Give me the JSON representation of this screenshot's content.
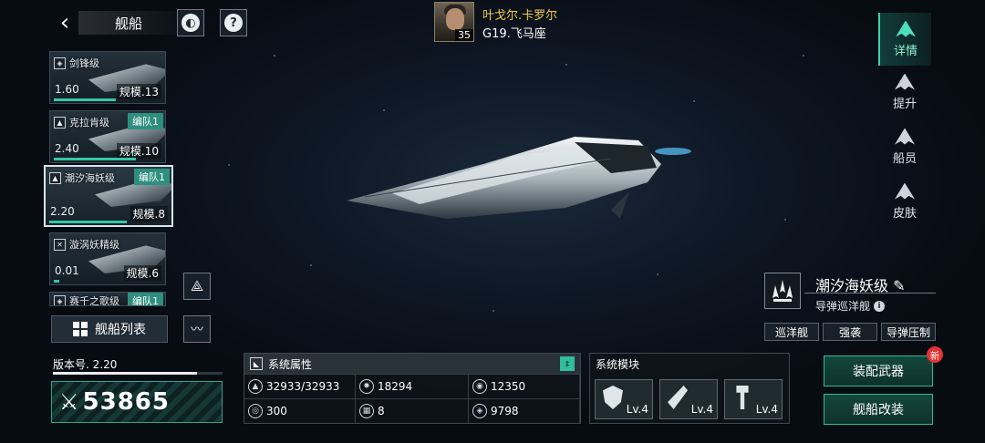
{
  "header": {
    "title": "舰船"
  },
  "commander": {
    "name": "叶戈尔.卡罗尔",
    "level": "35",
    "location": "G19.飞马座"
  },
  "ship_list": [
    {
      "name": "剑锋级",
      "version": "1.60",
      "scale": "规模.13",
      "fleet": "",
      "progress": 0.55
    },
    {
      "name": "克拉肯级",
      "version": "2.40",
      "scale": "规模.10",
      "fleet": "编队1",
      "progress": 0.75
    },
    {
      "name": "潮汐海妖级",
      "version": "2.20",
      "scale": "规模.8",
      "fleet": "编队1",
      "progress": 0.65
    },
    {
      "name": "漩涡妖精级",
      "version": "0.01",
      "scale": "规模.6",
      "fleet": "",
      "progress": 0.05
    },
    {
      "name": "赛千之歌级",
      "fleet": "编队1"
    }
  ],
  "ship_list_button": "舰船列表",
  "tabs": [
    {
      "label": "详情",
      "icon": "detail-icon",
      "active": true
    },
    {
      "label": "提升",
      "icon": "upgrade-icon",
      "active": false
    },
    {
      "label": "船员",
      "icon": "crew-icon",
      "active": false
    },
    {
      "label": "皮肤",
      "icon": "skin-icon",
      "active": false
    }
  ],
  "ship": {
    "name": "潮汐海妖级",
    "subtitle": "导弹巡洋舰",
    "tags": [
      "巡洋舰",
      "强袭",
      "导弹压制"
    ]
  },
  "version_label": "版本号. 2.20",
  "version_progress": 0.85,
  "power": "53865",
  "attributes": {
    "title": "系统属性",
    "items": [
      {
        "icon": "hull-icon",
        "value": "32933/32933"
      },
      {
        "icon": "firepower-icon",
        "value": "18294"
      },
      {
        "icon": "armor-icon",
        "value": "12350"
      },
      {
        "icon": "speed-icon",
        "value": "300"
      },
      {
        "icon": "command-icon",
        "value": "8"
      },
      {
        "icon": "energy-icon",
        "value": "9798"
      }
    ]
  },
  "modules": {
    "title": "系统模块",
    "items": [
      {
        "icon": "shield-module-icon",
        "level": "Lv.4"
      },
      {
        "icon": "missile-module-icon",
        "level": "Lv.4"
      },
      {
        "icon": "hammer-module-icon",
        "level": "Lv.4"
      }
    ]
  },
  "actions": {
    "equip": "装配武器",
    "refit": "舰船改装",
    "new_badge": "新"
  },
  "colors": {
    "accent": "#34c7a6",
    "gold": "#f3c94a",
    "badge": "#e03434"
  }
}
